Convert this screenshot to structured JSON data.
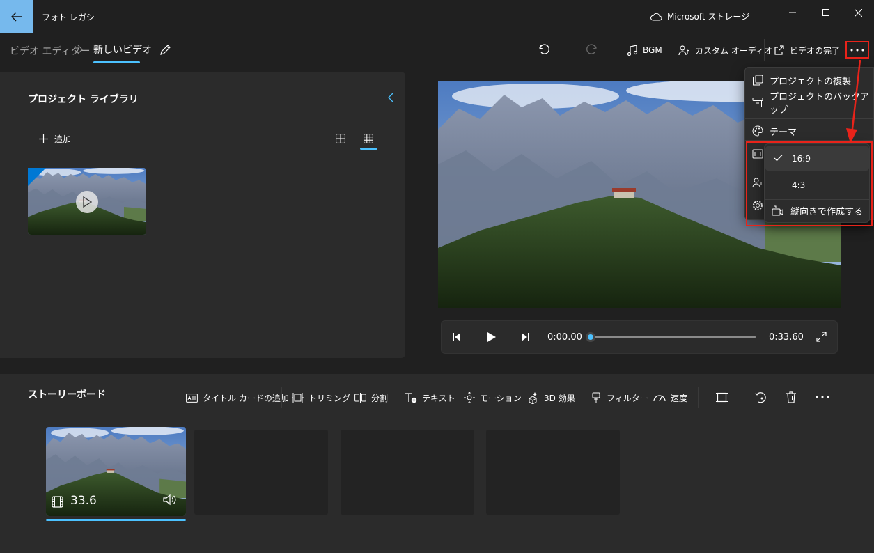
{
  "titlebar": {
    "app_title": "フォト レガシ",
    "storage_label": "Microsoft ストレージ"
  },
  "breadcrumb": {
    "root": "ビデオ エディター",
    "current": "新しいビデオ"
  },
  "toolbar": {
    "bgm_label": "BGM",
    "custom_audio_label": "カスタム オーディオ",
    "finish_video_label": "ビデオの完了",
    "more_label": "..."
  },
  "library": {
    "title": "プロジェクト ライブラリ",
    "add_label": "追加"
  },
  "player": {
    "current_time": "0:00.00",
    "total_time": "0:33.60",
    "progress": 0
  },
  "storyboard": {
    "title": "ストーリーボード",
    "actions": {
      "title_card": "タイトル カードの追加",
      "trim": "トリミング",
      "split": "分割",
      "text": "テキスト",
      "motion": "モーション",
      "effects_3d": "3D 効果",
      "filter": "フィルター",
      "speed": "速度"
    },
    "clip": {
      "duration": "33.6"
    }
  },
  "more_menu": {
    "items": [
      {
        "label": "プロジェクトの複製",
        "icon": "copy-icon"
      },
      {
        "label": "プロジェクトのバックアップ",
        "icon": "archive-icon"
      },
      {
        "label": "テーマ",
        "icon": "palette-icon"
      }
    ]
  },
  "aspect_submenu": {
    "items": [
      {
        "label": "16:9",
        "selected": true
      },
      {
        "label": "4:3",
        "selected": false
      },
      {
        "label": "縦向きで作成する",
        "selected": false
      }
    ]
  },
  "colors": {
    "accent": "#4cc2ff",
    "back_button": "#76b9ed",
    "highlight_red": "#e8231a",
    "thumb_corner": "#0078d4"
  }
}
